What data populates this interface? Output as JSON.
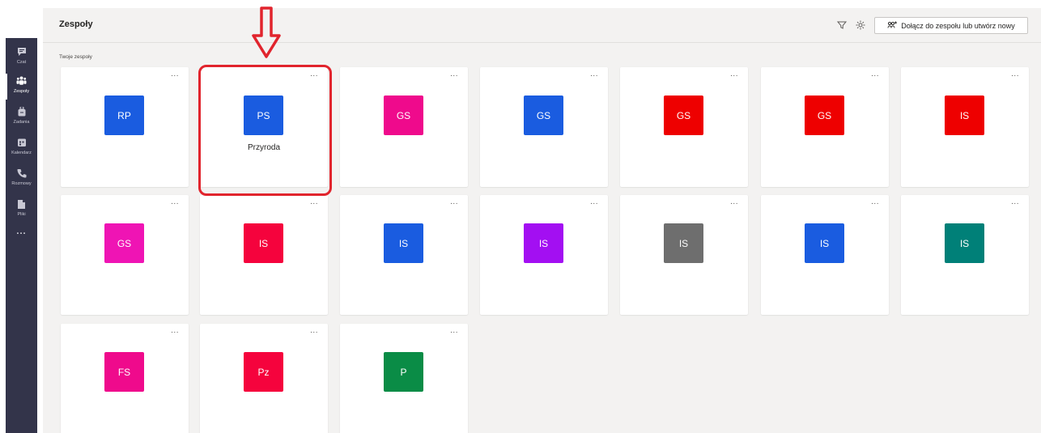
{
  "rail": {
    "items": [
      {
        "label": "Czat",
        "icon": "chat-icon",
        "active": false
      },
      {
        "label": "Zespoły",
        "icon": "teams-icon",
        "active": true
      },
      {
        "label": "Zadania",
        "icon": "assignments-icon",
        "active": false
      },
      {
        "label": "Kalendarz",
        "icon": "calendar-icon",
        "active": false
      },
      {
        "label": "Rozmowy",
        "icon": "phone-icon",
        "active": false
      },
      {
        "label": "Pliki",
        "icon": "files-icon",
        "active": false
      }
    ],
    "more": "..."
  },
  "header": {
    "title": "Zespoły",
    "join_label": "Dołącz do zespołu lub utwórz nowy"
  },
  "section": {
    "label": "Twoje zespoły"
  },
  "teams": [
    {
      "initials": "RP",
      "name": "",
      "color": "#1a5ce0",
      "more": "..."
    },
    {
      "initials": "PS",
      "name": "Przyroda",
      "color": "#1a5ce0",
      "more": "..."
    },
    {
      "initials": "GS",
      "name": "",
      "color": "#ef0a8c",
      "more": "..."
    },
    {
      "initials": "GS",
      "name": "",
      "color": "#1a5ce0",
      "more": "..."
    },
    {
      "initials": "GS",
      "name": "",
      "color": "#ee0000",
      "more": "..."
    },
    {
      "initials": "GS",
      "name": "",
      "color": "#ee0000",
      "more": "..."
    },
    {
      "initials": "IS",
      "name": "",
      "color": "#ee0000",
      "more": "..."
    },
    {
      "initials": "GS",
      "name": "",
      "color": "#ef14b4",
      "more": "..."
    },
    {
      "initials": "IS",
      "name": "",
      "color": "#f5033d",
      "more": "..."
    },
    {
      "initials": "IS",
      "name": "",
      "color": "#1a5ce0",
      "more": "..."
    },
    {
      "initials": "IS",
      "name": "",
      "color": "#a30ff2",
      "more": "..."
    },
    {
      "initials": "IS",
      "name": "",
      "color": "#6e6e6e",
      "more": "..."
    },
    {
      "initials": "IS",
      "name": "",
      "color": "#1a5ce0",
      "more": "..."
    },
    {
      "initials": "IS",
      "name": "",
      "color": "#008078",
      "more": "..."
    },
    {
      "initials": "FS",
      "name": "",
      "color": "#ef0a8c",
      "more": "..."
    },
    {
      "initials": "Pz",
      "name": "",
      "color": "#f5033d",
      "more": "..."
    },
    {
      "initials": "P",
      "name": "",
      "color": "#0a8c46",
      "more": "..."
    }
  ],
  "annotation": {
    "highlight_color": "#e1242d"
  }
}
